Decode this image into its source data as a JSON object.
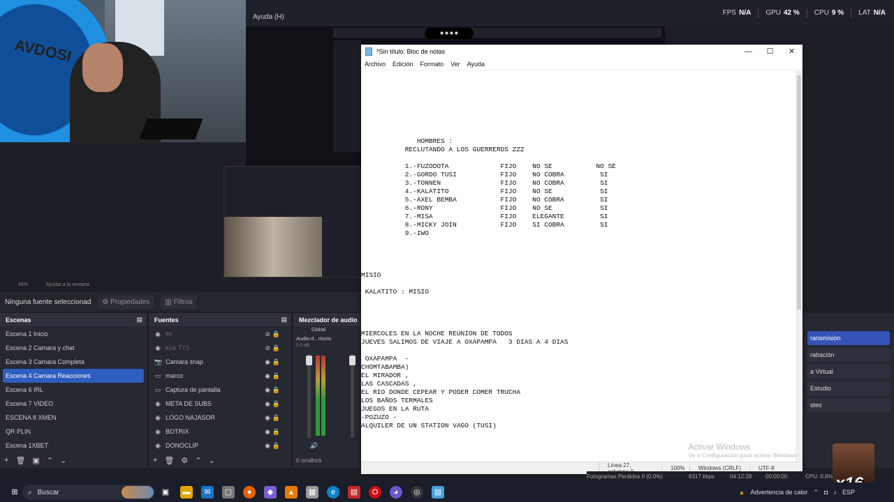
{
  "topbar": {
    "menu_help": "Ayuda (H)",
    "fps_label": "FPS",
    "fps_value": "N/A",
    "gpu_label": "GPU",
    "gpu_value": "42 %",
    "cpu_label": "CPU",
    "cpu_value": "9 %",
    "lat_label": "LAT",
    "lat_value": "N/A"
  },
  "zoom": {
    "value": "49%",
    "fit": "Ajustar a la ventana"
  },
  "props": {
    "no_source": "Ninguna fuente seleccionad",
    "properties": "Propiedades",
    "filters": "Filtros"
  },
  "scenes": {
    "title": "Escenas",
    "items": [
      "Escena 1 Inicio",
      "Escena 2  Camara y chat",
      "Escena 3 Camara Completa",
      "Escena 4  Camara Reacciones",
      "Escena 6 IRL",
      "Escena 7 VIDEO",
      "ESCENA 8 XMEN",
      "QR PLIN",
      "Escena 1XBET"
    ],
    "selected": 3
  },
  "sources": {
    "title": "Fuentes",
    "items": [
      "tts",
      "kick  TTS",
      "Camara snap",
      "marco",
      "Captura de pantalla",
      "META DE SUBS",
      "LOGO NAJASOR",
      "BOTRIX",
      "DONOCLIP"
    ],
    "hidden_label": "0 oculto/s"
  },
  "mixer": {
    "title": "Mezclador de audio",
    "global": "Global",
    "track": "Audio d...ritorio",
    "db": "0.0 dB"
  },
  "right_panel": {
    "stream": "ransmisión",
    "record": "rabación",
    "virtual": "a Virtual",
    "studio": "Estudio",
    "settings": "stes"
  },
  "notepad": {
    "title": "*Sin título: Bloc de notas",
    "menu": [
      "Archivo",
      "Edición",
      "Formato",
      "Ver",
      "Ayuda"
    ],
    "text": "\n\n\n\n\n\n\n\n              HOMBRES :\n           RECLUTANDO A LOS GUERREROS ZZZ\n\n           1.-FUZODOTA             FIJO    NO SE           NO SE\n           2.-GORDO TUSI           FIJO    NO COBRA         SI\n           3.-TONNEN               FIJO    NO COBRA         SI\n           4.-KALATITO             FIJO    NO SE            SI\n           5.-AXEL BEMBA           FIJO    NO COBRA         SI\n           6.-RONY                 FIJO    NO SE            SI\n           7.-MISA                 FIJO    ELEGANTE         SI\n           8.-MICKY JOIN           FIJO    SI COBRA         SI\n           9.-IWO\n\n\n\n\nMISIO\n\n KALATITO : MISIO\n\n\n\n\nMIERCOLES EN LA NOCHE REUNION DE TODOS\nJUEVES SALIMOS DE VIAJE A OXAPAMPA   3 DIAS A 4 DIAS\n\n OXAPAMPA  -\nCHOMTABAMBA)\nEL MIRADOR ,\nLAS CASCADAS ,\nEL RIO DONDE CEPEAR Y PODER COMER TRUCHA\nLOS BAÑOS TERMALES\nJUEGOS EN LA RUTA\n-POZUZO -\nALQUILER DE UN STATION VAGO (TUSI)",
    "status_pos": "Línea 27, columna 9",
    "status_zoom": "100%",
    "status_eol": "Windows (CRLF)",
    "status_enc": "UTF-8",
    "activate_title": "Activar Windows",
    "activate_sub": "Ve a Configuración para activar Windows"
  },
  "obs_status": {
    "frames": "Fotogramas Perdidos 0 (0.0%)",
    "kbps": "8317 kbps",
    "time": "04:12:28",
    "rec": "00:00:00",
    "cpu": "CPU: 0.8%"
  },
  "taskbar": {
    "search": "Buscar",
    "warning": "Advertencia de calor",
    "lang": "ESP"
  },
  "overlay": {
    "x16": "x16"
  }
}
